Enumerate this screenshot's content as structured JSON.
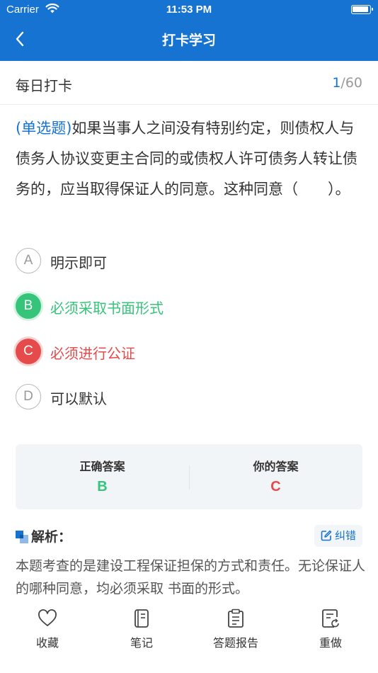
{
  "status_bar": {
    "carrier": "Carrier",
    "time": "11:53 PM"
  },
  "nav": {
    "title": "打卡学习",
    "back_icon": "chevron-left-icon"
  },
  "header": {
    "title": "每日打卡",
    "current": "1",
    "total": "/60"
  },
  "question": {
    "type_label": "(单选题)",
    "text": "如果当事人之间没有特别约定，则债权人与债务人协议变更主合同的或债权人许可债务人转让债务的，应当取得保证人的同意。这种同意（　　）。"
  },
  "options": [
    {
      "letter": "A",
      "text": "明示即可",
      "state": "normal"
    },
    {
      "letter": "B",
      "text": "必须采取书面形式",
      "state": "correct"
    },
    {
      "letter": "C",
      "text": "必须进行公证",
      "state": "wrong"
    },
    {
      "letter": "D",
      "text": "可以默认",
      "state": "normal"
    }
  ],
  "answer_box": {
    "correct_label": "正确答案",
    "correct_value": "B",
    "your_label": "你的答案",
    "your_value": "C"
  },
  "analysis": {
    "title": "解析：",
    "report_label": "纠错",
    "text": "本题考查的是建设工程保证担保的方式和责任。无论保证人的哪种同意，均必须采取 书面的形式。"
  },
  "bottom_tabs": [
    {
      "label": "收藏",
      "icon": "heart-icon"
    },
    {
      "label": "笔记",
      "icon": "notebook-icon"
    },
    {
      "label": "答题报告",
      "icon": "clipboard-icon"
    },
    {
      "label": "重做",
      "icon": "redo-icon"
    }
  ],
  "colors": {
    "brand": "#1673d1",
    "correct": "#35c47a",
    "wrong": "#e54b4b"
  }
}
